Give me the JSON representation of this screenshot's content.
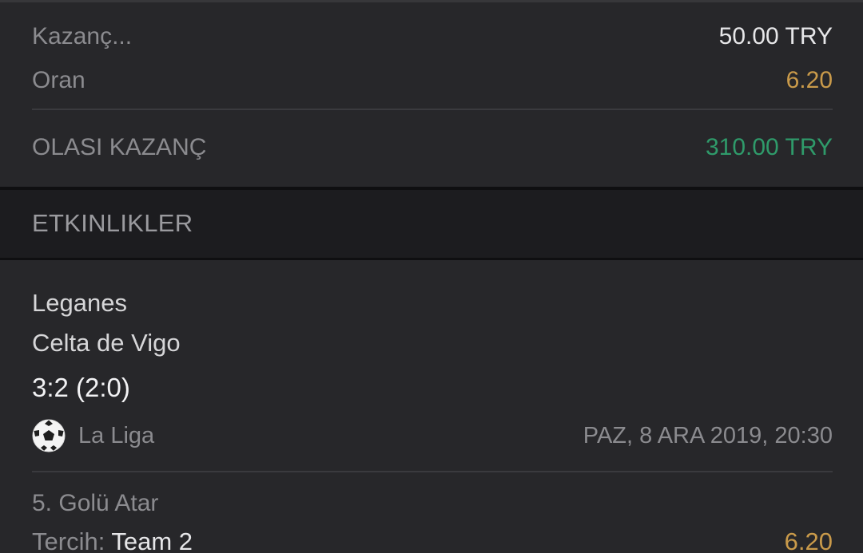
{
  "summary": {
    "stake_label": "Kazanç...",
    "stake_value": "50.00 TRY",
    "odds_label": "Oran",
    "odds_value": "6.20",
    "potential_label": "OLASI KAZANÇ",
    "potential_value": "310.00 TRY"
  },
  "events_section": {
    "title": "ETKINLIKLER"
  },
  "event": {
    "home_team": "Leganes",
    "away_team": "Celta de Vigo",
    "score": "3:2 (2:0)",
    "sport_icon": "soccer-ball-icon",
    "league": "La Liga",
    "datetime": "PAZ, 8 ARA 2019, 20:30",
    "market": "5. Golü Atar",
    "pick_label": "Tercih:",
    "pick_value": "Team 2",
    "pick_odds": "6.20"
  },
  "colors": {
    "background": "#27272a",
    "section_band": "#1c1c1f",
    "odds_gold": "#c99a4a",
    "win_green": "#2f9a6a",
    "muted_text": "#8b8b8f"
  }
}
